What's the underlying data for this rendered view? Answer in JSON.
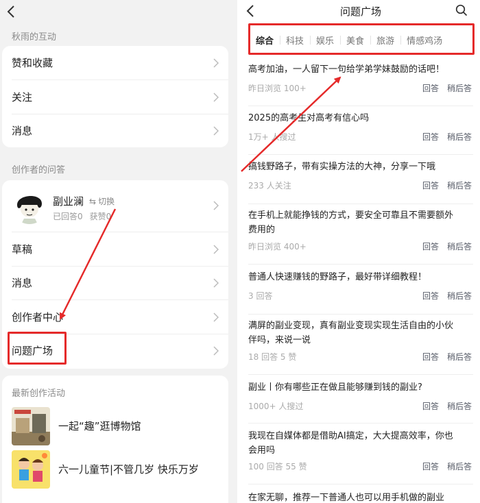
{
  "left": {
    "section1_title": "秋雨的互动",
    "rows1": [
      "赞和收藏",
      "关注",
      "消息"
    ],
    "section2_title": "创作者的问答",
    "creator": {
      "name": "副业澜",
      "switch_label": "切换",
      "answered": "已回答0",
      "likes": "获赞0"
    },
    "rows2": [
      "草稿",
      "消息",
      "创作者中心",
      "问题广场"
    ],
    "section3_title": "最新创作活动",
    "activities": [
      "一起“趣”逛博物馆",
      "六一儿童节|不管几岁 快乐万岁"
    ]
  },
  "right": {
    "title": "问题广场",
    "tabs": [
      "综合",
      "科技",
      "娱乐",
      "美食",
      "旅游",
      "情感鸡汤"
    ],
    "active_tab": "综合",
    "answer_label": "回答",
    "later_label": "稍后答",
    "questions": [
      {
        "title": "高考加油，一人留下一句给学弟学妹鼓励的话吧！",
        "meta": "昨日浏览 100+"
      },
      {
        "title": "2025的高考生对高考有信心吗",
        "meta": "1万+ 人搜过"
      },
      {
        "title": "搞钱野路子，带有实操方法的大神，分享一下哦",
        "meta": "233 人关注"
      },
      {
        "title": "在手机上就能挣钱的方式，要安全可靠且不需要额外费用的",
        "meta": "昨日浏览 400+"
      },
      {
        "title": "普通人快速赚钱的野路子，最好带详细教程！",
        "meta": "3 回答"
      },
      {
        "title": "满屏的副业变现，真有副业变现实现生活自由的小伙伴吗，来说一说",
        "meta": "18 回答  5 赞"
      },
      {
        "title": "副业丨你有哪些正在做且能够赚到钱的副业?",
        "meta": "1000+ 人搜过"
      },
      {
        "title": "我现在自媒体都是借助AI搞定，大大提高效率，你也会用吗",
        "meta": "100 回答  55 赞"
      },
      {
        "title": "在家无聊，推荐一下普通人也可以用手机做的副业",
        "meta": ""
      }
    ]
  },
  "colors": {
    "highlight": "#e52a2a",
    "action": "#4a6a9a"
  }
}
